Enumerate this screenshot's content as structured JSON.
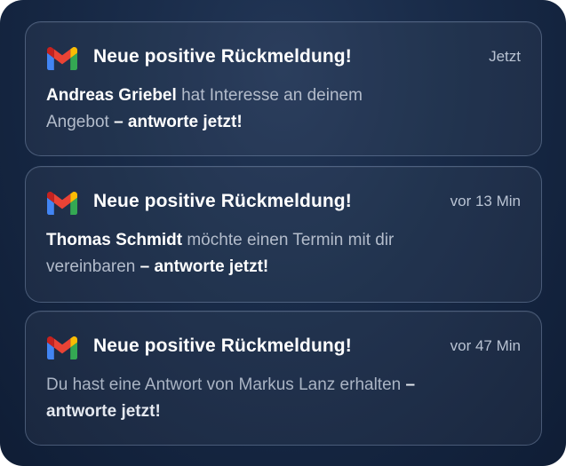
{
  "notifications": [
    {
      "app_icon": "gmail-icon",
      "title": "Neue positive Rückmeldung!",
      "time": "Jetzt",
      "sender": "Andreas Griebel",
      "message": "hat Interesse an deinem Angebot",
      "cta": "– antworte jetzt!"
    },
    {
      "app_icon": "gmail-icon",
      "title": "Neue positive Rückmeldung!",
      "time": "vor 13 Min",
      "sender": "Thomas Schmidt",
      "message": "möchte einen Termin mit dir vereinbaren",
      "cta": "– antworte jetzt!"
    },
    {
      "app_icon": "gmail-icon",
      "title": "Neue positive Rückmeldung!",
      "time": "vor 47 Min",
      "message": "Du hast eine Antwort von Markus Lanz erhalten",
      "cta": "– antworte jetzt!"
    }
  ],
  "colors": {
    "background": "#172845",
    "title": "#ffffff",
    "body_text": "#b3bccb",
    "gmail_red": "#EA4335",
    "gmail_blue": "#4285F4",
    "gmail_green": "#34A853",
    "gmail_yellow": "#FBBC04",
    "gmail_dark_red": "#C5221F"
  }
}
